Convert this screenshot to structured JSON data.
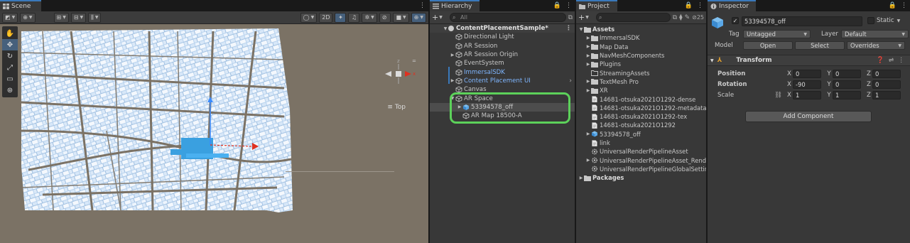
{
  "scene": {
    "tab_label": "Scene",
    "toolbar": {
      "mode_2d": "2D",
      "top_label": "Top"
    },
    "tools": [
      "hand-tool",
      "move-tool",
      "rotate-tool",
      "scale-tool",
      "rect-tool",
      "transform-tool"
    ]
  },
  "hierarchy": {
    "tab_label": "Hierarchy",
    "search_placeholder": "All",
    "root": "ContentPlacementSample*",
    "items": [
      {
        "label": "Directional Light",
        "depth": 1,
        "arrow": ""
      },
      {
        "label": "AR Session",
        "depth": 1,
        "arrow": ""
      },
      {
        "label": "AR Session Origin",
        "depth": 1,
        "arrow": "right"
      },
      {
        "label": "EventSystem",
        "depth": 1,
        "arrow": ""
      },
      {
        "label": "ImmersalSDK",
        "depth": 1,
        "arrow": "",
        "blue": true
      },
      {
        "label": "Content Placement UI",
        "depth": 1,
        "arrow": "right",
        "blue": true
      },
      {
        "label": "Canvas",
        "depth": 1,
        "arrow": ""
      },
      {
        "label": "AR Space",
        "depth": 1,
        "arrow": "down"
      },
      {
        "label": "53394578_off",
        "depth": 2,
        "arrow": "right",
        "selected": true
      },
      {
        "label": "AR Map 18500-A",
        "depth": 2,
        "arrow": ""
      }
    ]
  },
  "project": {
    "tab_label": "Project",
    "hidden_count": "25",
    "items": [
      {
        "label": "Assets",
        "depth": 0,
        "arrow": "down",
        "icon": "folder",
        "bold": true
      },
      {
        "label": "ImmersalSDK",
        "depth": 1,
        "arrow": "right",
        "icon": "folder"
      },
      {
        "label": "Map Data",
        "depth": 1,
        "arrow": "right",
        "icon": "folder"
      },
      {
        "label": "NavMeshComponents",
        "depth": 1,
        "arrow": "right",
        "icon": "folder"
      },
      {
        "label": "Plugins",
        "depth": 1,
        "arrow": "right",
        "icon": "folder"
      },
      {
        "label": "StreamingAssets",
        "depth": 1,
        "arrow": "",
        "icon": "folder-empty"
      },
      {
        "label": "TextMesh Pro",
        "depth": 1,
        "arrow": "right",
        "icon": "folder"
      },
      {
        "label": "XR",
        "depth": 1,
        "arrow": "right",
        "icon": "folder"
      },
      {
        "label": "14681-otsuka2021O1292-dense",
        "depth": 1,
        "arrow": "",
        "icon": "file"
      },
      {
        "label": "14681-otsuka2021O1292-metadata",
        "depth": 1,
        "arrow": "",
        "icon": "file"
      },
      {
        "label": "14681-otsuka2021O1292-tex",
        "depth": 1,
        "arrow": "",
        "icon": "file"
      },
      {
        "label": "14681-otsuka2021O1292",
        "depth": 1,
        "arrow": "",
        "icon": "file"
      },
      {
        "label": "53394578_off",
        "depth": 1,
        "arrow": "right",
        "icon": "prefab"
      },
      {
        "label": "link",
        "depth": 1,
        "arrow": "",
        "icon": "file"
      },
      {
        "label": "UniversalRenderPipelineAsset",
        "depth": 1,
        "arrow": "",
        "icon": "gear"
      },
      {
        "label": "UniversalRenderPipelineAsset_Renderer",
        "depth": 1,
        "arrow": "right",
        "icon": "gear"
      },
      {
        "label": "UniversalRenderPipelineGlobalSettings",
        "depth": 1,
        "arrow": "",
        "icon": "gear"
      },
      {
        "label": "Packages",
        "depth": 0,
        "arrow": "right",
        "icon": "folder",
        "bold": true
      }
    ]
  },
  "inspector": {
    "tab_label": "Inspector",
    "object_name": "53394578_off",
    "static_label": "Static",
    "tag_label": "Tag",
    "tag_value": "Untagged",
    "layer_label": "Layer",
    "layer_value": "Default",
    "model_label": "Model",
    "open_label": "Open",
    "select_label": "Select",
    "overrides_label": "Overrides",
    "transform_label": "Transform",
    "position_label": "Position",
    "rotation_label": "Rotation",
    "scale_label": "Scale",
    "position": {
      "x": "0",
      "y": "0",
      "z": "0"
    },
    "rotation": {
      "x": "-90",
      "y": "0",
      "z": "0"
    },
    "scale": {
      "x": "1",
      "y": "1",
      "z": "1"
    },
    "add_component_label": "Add Component"
  },
  "colors": {
    "accent_blue": "#3a79bb",
    "highlight_green": "#5cd15a",
    "selected_bg": "#4d4d4d"
  }
}
